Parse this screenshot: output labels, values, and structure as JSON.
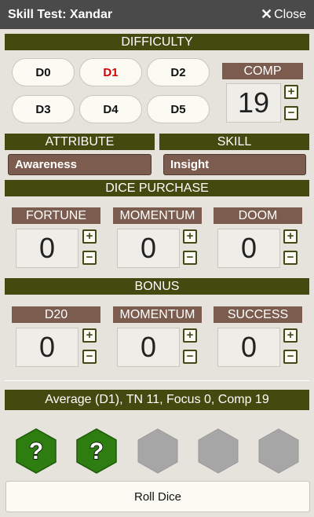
{
  "window": {
    "title": "Skill Test: Xandar",
    "close_label": "Close"
  },
  "difficulty": {
    "header": "DIFFICULTY",
    "buttons": [
      "D0",
      "D1",
      "D2",
      "D3",
      "D4",
      "D5"
    ],
    "selected": "D1",
    "comp_label": "COMP",
    "comp_value": "19"
  },
  "attribute": {
    "header": "ATTRIBUTE",
    "value": "Awareness"
  },
  "skill": {
    "header": "SKILL",
    "value": "Insight"
  },
  "dice_purchase": {
    "header": "DICE PURCHASE",
    "fortune": {
      "label": "FORTUNE",
      "value": "0"
    },
    "momentum": {
      "label": "MOMENTUM",
      "value": "0"
    },
    "doom": {
      "label": "DOOM",
      "value": "0"
    }
  },
  "bonus": {
    "header": "BONUS",
    "d20": {
      "label": "D20",
      "value": "0"
    },
    "momentum": {
      "label": "MOMENTUM",
      "value": "0"
    },
    "success": {
      "label": "SUCCESS",
      "value": "0"
    }
  },
  "summary": "Average (D1), TN 11, Focus 0, Comp 19",
  "dice": [
    {
      "state": "active",
      "glyph": "?"
    },
    {
      "state": "active",
      "glyph": "?"
    },
    {
      "state": "inactive",
      "glyph": ""
    },
    {
      "state": "inactive",
      "glyph": ""
    },
    {
      "state": "inactive",
      "glyph": ""
    }
  ],
  "colors": {
    "dark_olive": "#44490f",
    "brown": "#7b5c4e",
    "die_active": "#2e7d11",
    "die_inactive": "#a6a6a6",
    "selected_red": "#d10000"
  },
  "roll_button": "Roll Dice"
}
